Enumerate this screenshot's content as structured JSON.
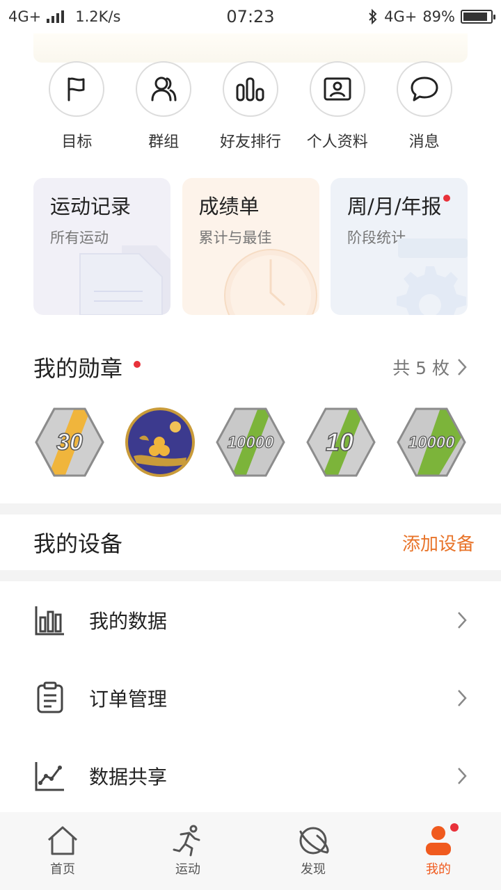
{
  "status_bar": {
    "network": "4G+",
    "speed": "1.2K/s",
    "time": "07:23",
    "network_right": "4G+",
    "battery": "89%",
    "battery_level": 0.89
  },
  "quick_actions": [
    {
      "label": "目标",
      "icon": "flag-icon"
    },
    {
      "label": "群组",
      "icon": "group-icon"
    },
    {
      "label": "好友排行",
      "icon": "ranking-icon"
    },
    {
      "label": "个人资料",
      "icon": "profile-card-icon"
    },
    {
      "label": "消息",
      "icon": "message-icon"
    }
  ],
  "cards": [
    {
      "title": "运动记录",
      "subtitle": "所有运动",
      "bg": "#f1f0f7"
    },
    {
      "title": "成绩单",
      "subtitle": "累计与最佳",
      "bg": "#fdf3ea"
    },
    {
      "title": "周/月/年报",
      "subtitle": "阶段统计",
      "bg": "#eef2f8"
    }
  ],
  "medals": {
    "title": "我的勋章",
    "count_label": "共 5 枚",
    "items": [
      {
        "text": "30",
        "stripe": "#f0b53c"
      },
      {
        "text": "",
        "stripe": "#3c3a8e"
      },
      {
        "text": "10000",
        "stripe": "#7cb43a"
      },
      {
        "text": "10",
        "stripe": "#7cb43a"
      },
      {
        "text": "10000",
        "stripe": "#7cb43a"
      }
    ]
  },
  "devices": {
    "title": "我的设备",
    "add_label": "添加设备",
    "accent": "#e8742a"
  },
  "menu": [
    {
      "label": "我的数据",
      "icon": "bar-chart-icon"
    },
    {
      "label": "订单管理",
      "icon": "clipboard-icon"
    },
    {
      "label": "数据共享",
      "icon": "line-chart-icon"
    }
  ],
  "bottom_nav": [
    {
      "label": "首页",
      "icon": "home-icon"
    },
    {
      "label": "运动",
      "icon": "running-icon"
    },
    {
      "label": "发现",
      "icon": "planet-icon"
    },
    {
      "label": "我的",
      "icon": "person-icon",
      "active": true
    }
  ]
}
